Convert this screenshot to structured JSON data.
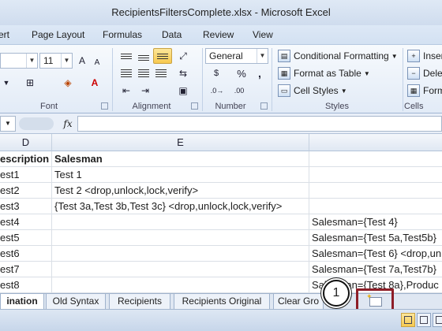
{
  "window": {
    "title": "RecipientsFiltersComplete.xlsx - Microsoft Excel"
  },
  "ribbon_tabs": [
    "ert",
    "Page Layout",
    "Formulas",
    "Data",
    "Review",
    "View"
  ],
  "ribbon": {
    "font": {
      "size": "11",
      "group_label": "Font"
    },
    "alignment": {
      "group_label": "Alignment"
    },
    "number": {
      "format": "General",
      "symbols": [
        "$",
        "%",
        ","
      ],
      "group_label": "Number"
    },
    "styles": {
      "conditional_formatting": "Conditional Formatting",
      "format_as_table": "Format as Table",
      "cell_styles": "Cell Styles",
      "group_label": "Styles"
    },
    "cells": {
      "insert": "Inser",
      "delete": "Dele",
      "format": "Form",
      "group_label": "Cells"
    }
  },
  "formula_bar": {
    "fx_label": "fx",
    "value": ""
  },
  "grid": {
    "columns": [
      "D",
      "E",
      ""
    ],
    "rows": [
      {
        "d": "escription",
        "e": "Salesman",
        "f": "",
        "header": true
      },
      {
        "d": "est1",
        "e": "Test 1",
        "f": ""
      },
      {
        "d": "est2",
        "e": "Test 2  <drop,unlock,lock,verify>",
        "f": ""
      },
      {
        "d": "est3",
        "e": "{Test 3a,Test 3b,Test 3c}  <drop,unlock,lock,verify>",
        "f": ""
      },
      {
        "d": "est4",
        "e": "",
        "f": "Salesman={Test 4}"
      },
      {
        "d": "est5",
        "e": "",
        "f": "Salesman={Test 5a,Test5b}"
      },
      {
        "d": "est6",
        "e": "",
        "f": "Salesman={Test 6} <drop,un"
      },
      {
        "d": "est7",
        "e": "",
        "f": "Salesman={Test 7a,Test7b}"
      },
      {
        "d": "est8",
        "e": "",
        "f": "Salesman={Test 8a},Produc"
      }
    ]
  },
  "sheet_tabs": [
    {
      "label": "ination",
      "active": true
    },
    {
      "label": "Old Syntax",
      "active": false
    },
    {
      "label": "Recipients",
      "active": false
    },
    {
      "label": "Recipients Original",
      "active": false
    },
    {
      "label": "Clear Gro",
      "active": false
    }
  ],
  "callout": {
    "number": "1"
  },
  "colors": {
    "accent": "#f7c94f",
    "highlight_border": "#8e1e28"
  }
}
